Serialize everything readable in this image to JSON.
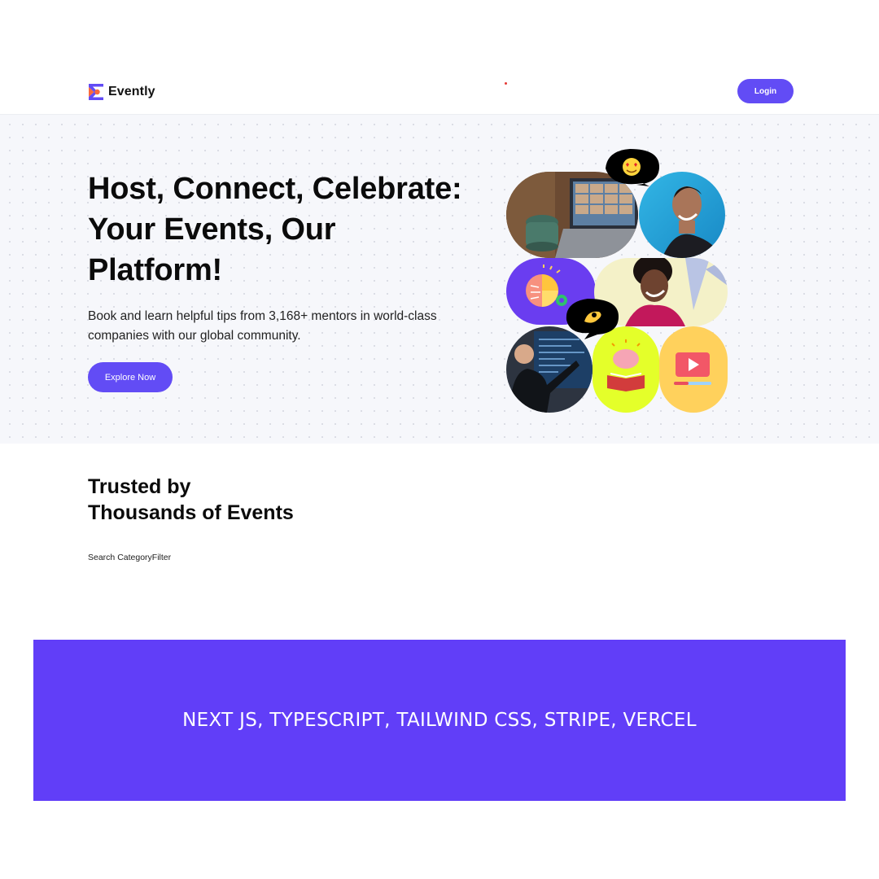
{
  "header": {
    "brand": "Evently",
    "login_label": "Login",
    "colors": {
      "accent": "#624cf5",
      "logo_orange": "#fb6a3c"
    }
  },
  "hero": {
    "title": "Host, Connect, Celebrate: Your Events, Our Platform!",
    "subtitle": "Book and learn helpful tips from 3,168+ mentors in world-class companies with our global community.",
    "cta_label": "Explore Now",
    "collage_tiles": [
      "video-call-laptop-photo",
      "laughing-man-photo",
      "brain-lightbulb-illustration",
      "smiling-woman-photo",
      "presenter-at-screen-photo",
      "brain-book-illustration",
      "video-play-illustration"
    ],
    "bubble_icons": [
      "heart-eyes-emoji-icon",
      "ok-hand-emoji-icon"
    ]
  },
  "trusted": {
    "title_line1": "Trusted by",
    "title_line2": "Thousands of Events",
    "search_label": "Search",
    "category_label": "CategoryFilter"
  },
  "banner": {
    "text": "NEXT JS, TYPESCRIPT, TAILWIND CSS, STRIPE, VERCEL",
    "color": "#613ef8"
  }
}
